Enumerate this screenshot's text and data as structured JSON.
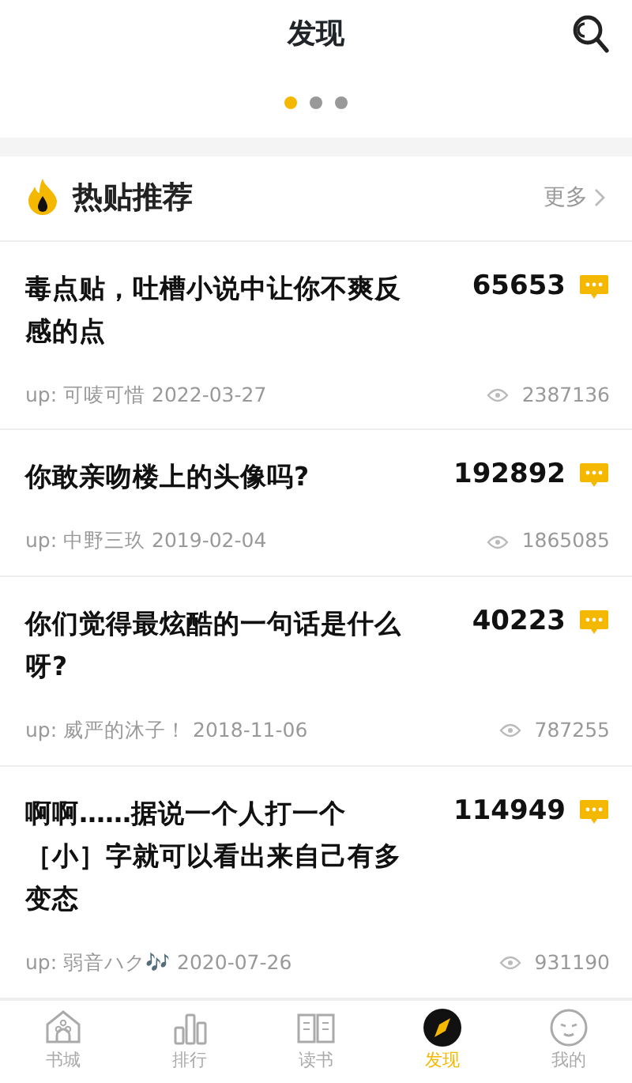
{
  "header": {
    "title": "发现"
  },
  "carousel": {
    "dots": [
      {
        "selected": true
      },
      {
        "selected": false
      },
      {
        "selected": false
      }
    ]
  },
  "section": {
    "title": "热贴推荐",
    "more": "更多"
  },
  "posts": [
    {
      "title": "毒点贴，吐槽小说中让你不爽反感的点",
      "replies": "65653",
      "author": "up: 可唛可惜",
      "date": "2022-03-27",
      "views": "2387136"
    },
    {
      "title": "你敢亲吻楼上的头像吗?",
      "replies": "192892",
      "author": "up: 中野三玖",
      "date": "2019-02-04",
      "views": "1865085"
    },
    {
      "title": "你们觉得最炫酷的一句话是什么呀?",
      "replies": "40223",
      "author": "up: 威严的沐子！",
      "date": "2018-11-06",
      "views": "787255"
    },
    {
      "title": "啊啊……据说一个人打一个［小］字就可以看出来自己有多变态",
      "replies": "114949",
      "author": "up: 弱音ハク",
      "author_emoji": "🎶",
      "date": "2020-07-26",
      "views": "931190"
    }
  ],
  "tabbar": [
    {
      "label": "书城",
      "kind": "home",
      "selected": false
    },
    {
      "label": "排行",
      "kind": "rank",
      "selected": false
    },
    {
      "label": "读书",
      "kind": "book",
      "selected": false
    },
    {
      "label": "发现",
      "kind": "discover",
      "selected": true
    },
    {
      "label": "我的",
      "kind": "me",
      "selected": false
    }
  ]
}
